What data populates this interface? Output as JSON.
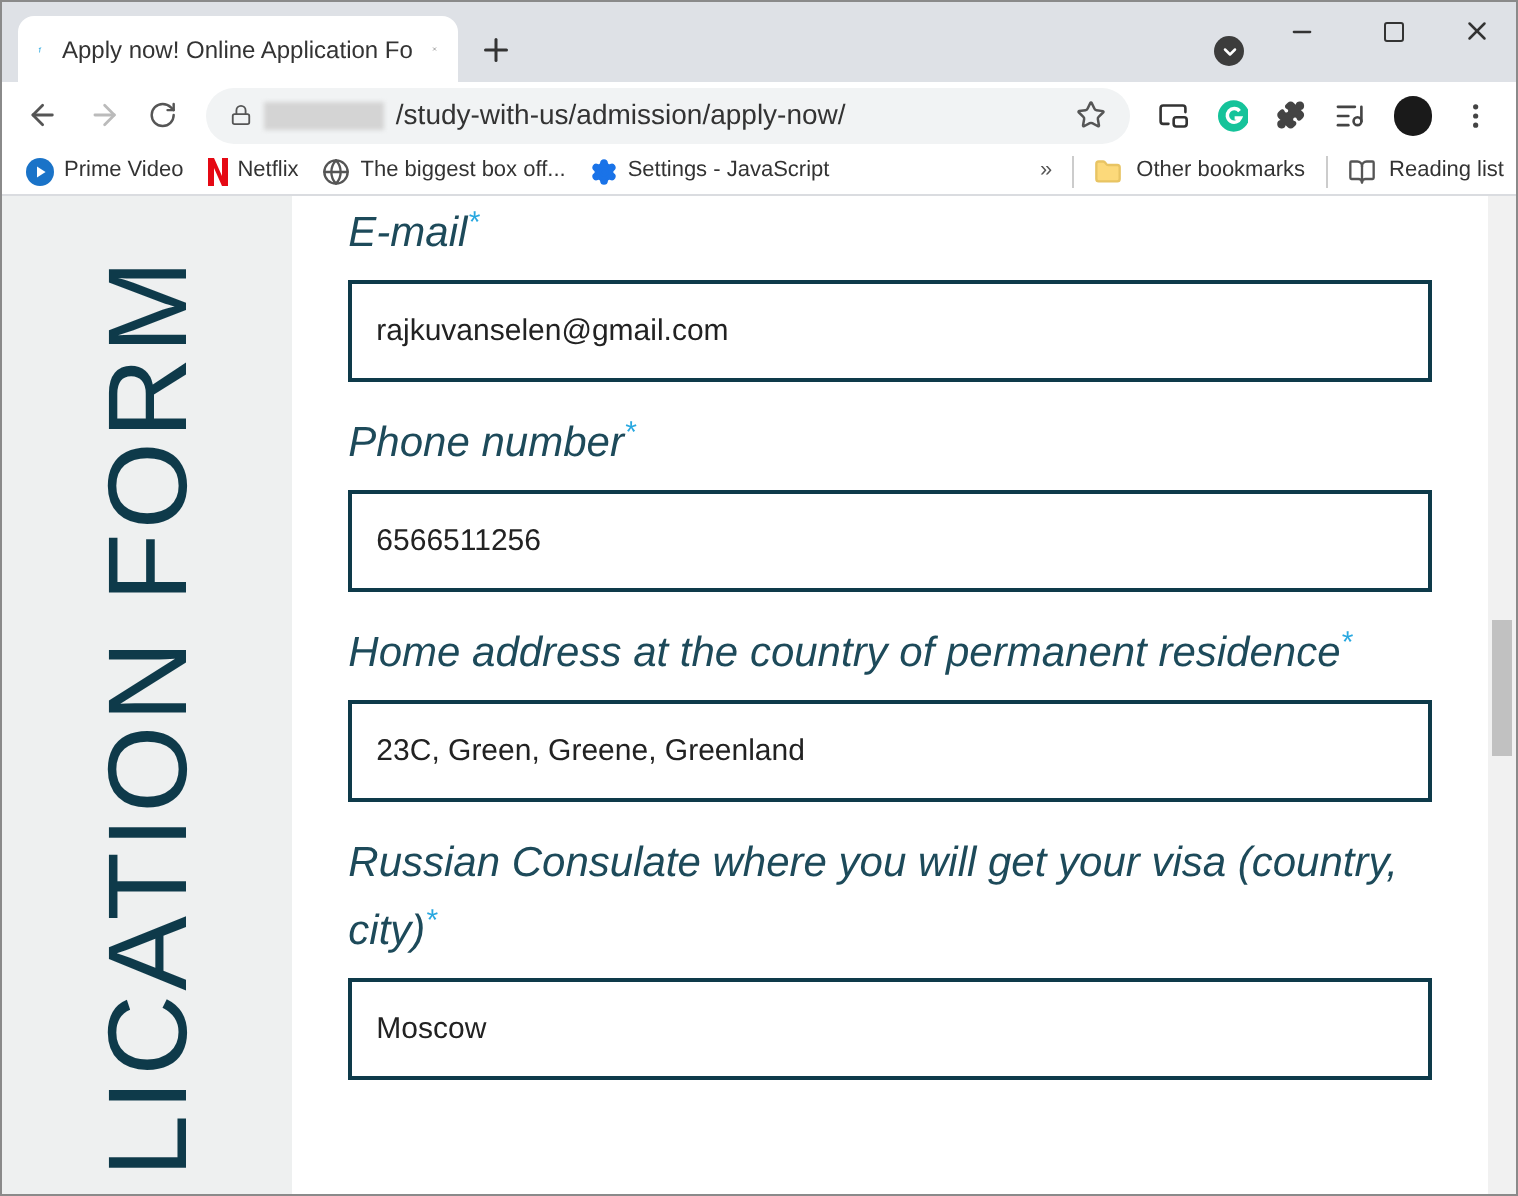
{
  "tab": {
    "title": "Apply now! Online Application Fo"
  },
  "address_bar": {
    "url": "/study-with-us/admission/apply-now/"
  },
  "bookmarks": [
    {
      "label": "Prime Video",
      "kind": "play"
    },
    {
      "label": "Netflix",
      "kind": "netflix"
    },
    {
      "label": "The biggest box off...",
      "kind": "globe"
    },
    {
      "label": "Settings - JavaScript",
      "kind": "gear"
    }
  ],
  "bookmarks_overflow": "»",
  "other_bookmarks": "Other bookmarks",
  "reading_list": "Reading list",
  "side_title": "LICATION FORM",
  "fields": [
    {
      "label": "E-mail",
      "required": true,
      "value": "rajkuvanselen@gmail.com"
    },
    {
      "label": "Phone number",
      "required": true,
      "value": "6566511256"
    },
    {
      "label": "Home address at the country of permanent residence",
      "required": true,
      "value": "23C, Green, Greene, Greenland"
    },
    {
      "label": "Russian Consulate where you will get your visa (country, city)",
      "required": true,
      "value": "Moscow"
    }
  ],
  "required_mark": "*"
}
